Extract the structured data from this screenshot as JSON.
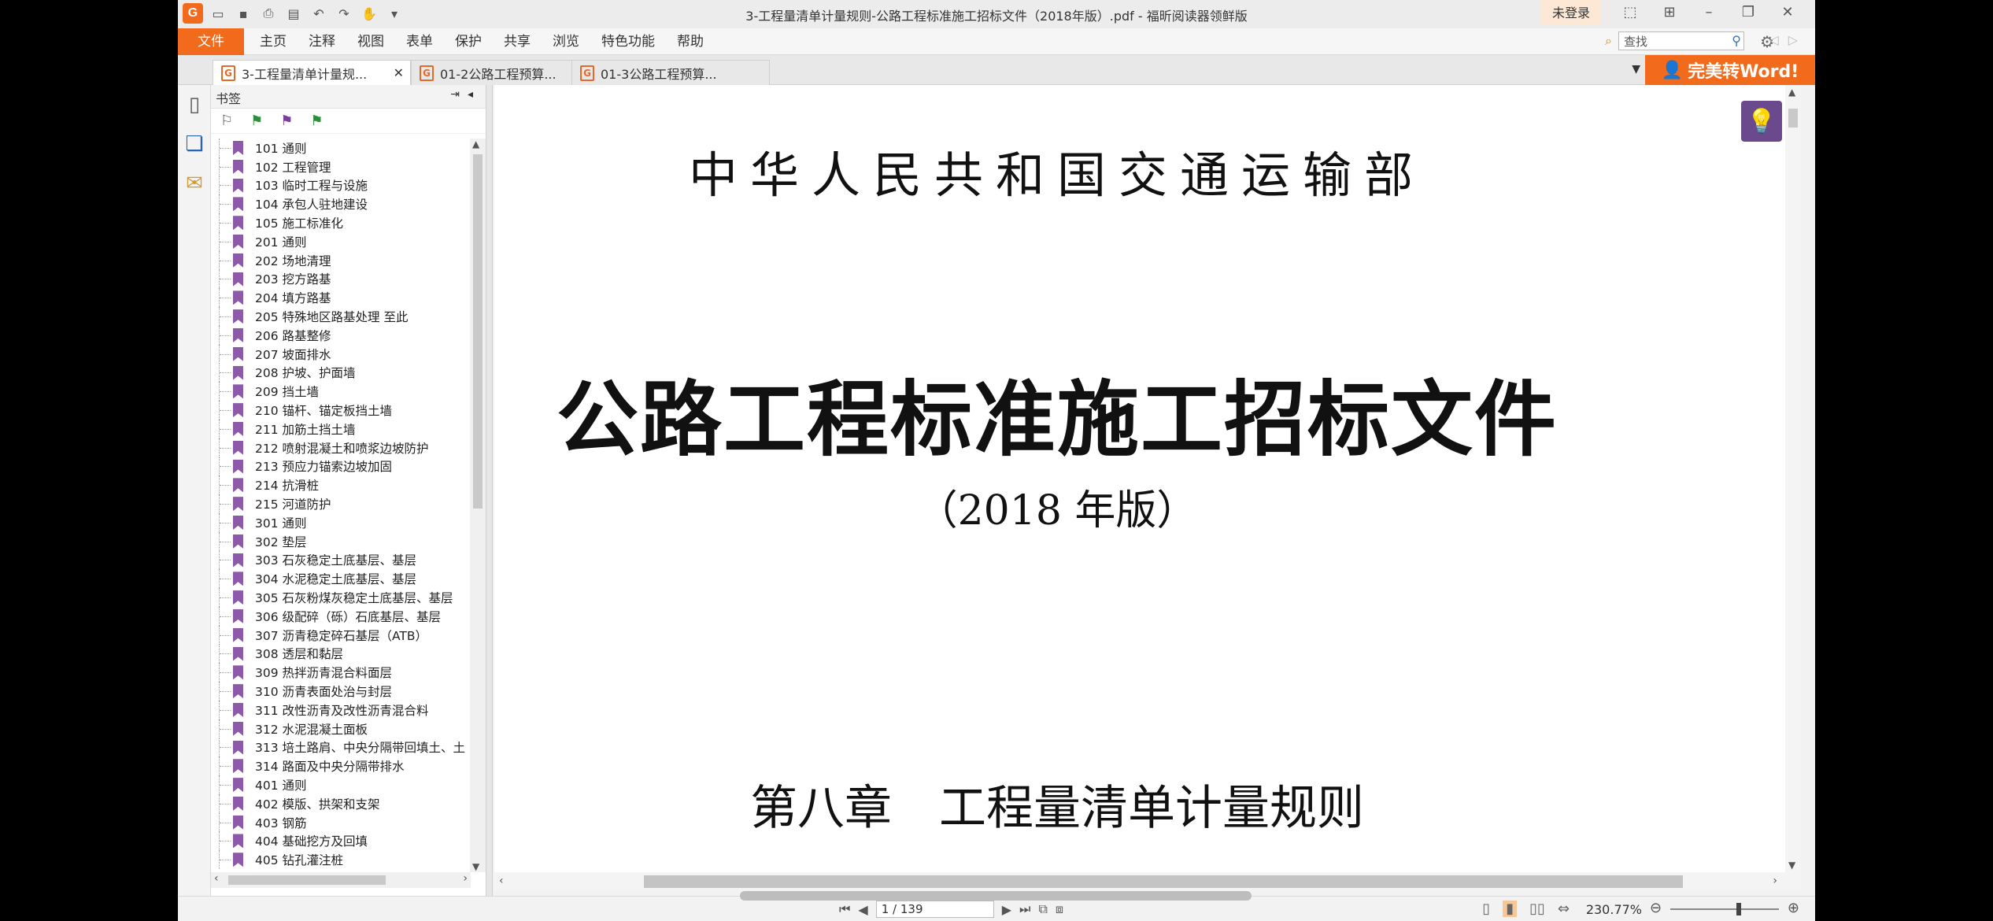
{
  "window": {
    "title": "3-工程量清单计量规则-公路工程标准施工招标文件（2018年版）.pdf - 福昕阅读器领鲜版",
    "login": "未登录"
  },
  "menubar": {
    "items": [
      "文件",
      "主页",
      "注释",
      "视图",
      "表单",
      "保护",
      "共享",
      "浏览",
      "特色功能",
      "帮助"
    ],
    "search_placeholder": "查找"
  },
  "tabs": [
    {
      "label": "3-工程量清单计量规...",
      "active": true
    },
    {
      "label": "01-2公路工程预算...",
      "active": false
    },
    {
      "label": "01-3公路工程预算...",
      "active": false
    }
  ],
  "convert_button": "完美转Word!",
  "bookmarks": {
    "title": "书签",
    "items": [
      "101 通则",
      "102 工程管理",
      "103 临时工程与设施",
      "104 承包人驻地建设",
      "105 施工标准化",
      "201 通则",
      "202 场地清理",
      "203 挖方路基",
      "204 填方路基",
      "205 特殊地区路基处理 至此",
      "206 路基整修",
      "207 坡面排水",
      "208 护坡、护面墙",
      "209 挡土墙",
      "210 锚杆、锚定板挡土墙",
      "211 加筋土挡土墙",
      "212 喷射混凝土和喷浆边坡防护",
      "213 预应力锚索边坡加固",
      "214 抗滑桩",
      "215 河道防护",
      "301 通则",
      "302 垫层",
      "303 石灰稳定土底基层、基层",
      "304 水泥稳定土底基层、基层",
      "305 石灰粉煤灰稳定土底基层、基层",
      "306 级配碎（砾）石底基层、基层",
      "307 沥青稳定碎石基层（ATB）",
      "308 透层和黏层",
      "309 热拌沥青混合料面层",
      "310 沥青表面处治与封层",
      "311 改性沥青及改性沥青混合料",
      "312 水泥混凝土面板",
      "313 培土路肩、中央分隔带回填土、土",
      "314 路面及中央分隔带排水",
      "401 通则",
      "402 模版、拱架和支架",
      "403 钢筋",
      "404 基础挖方及回填",
      "405 钻孔灌注桩"
    ]
  },
  "document": {
    "line1": "中华人民共和国交通运输部",
    "line2": "公路工程标准施工招标文件",
    "line3": "（2018 年版）",
    "line4": "第八章　工程量清单计量规则"
  },
  "status": {
    "page": "1 / 139",
    "zoom": "230.77%"
  }
}
